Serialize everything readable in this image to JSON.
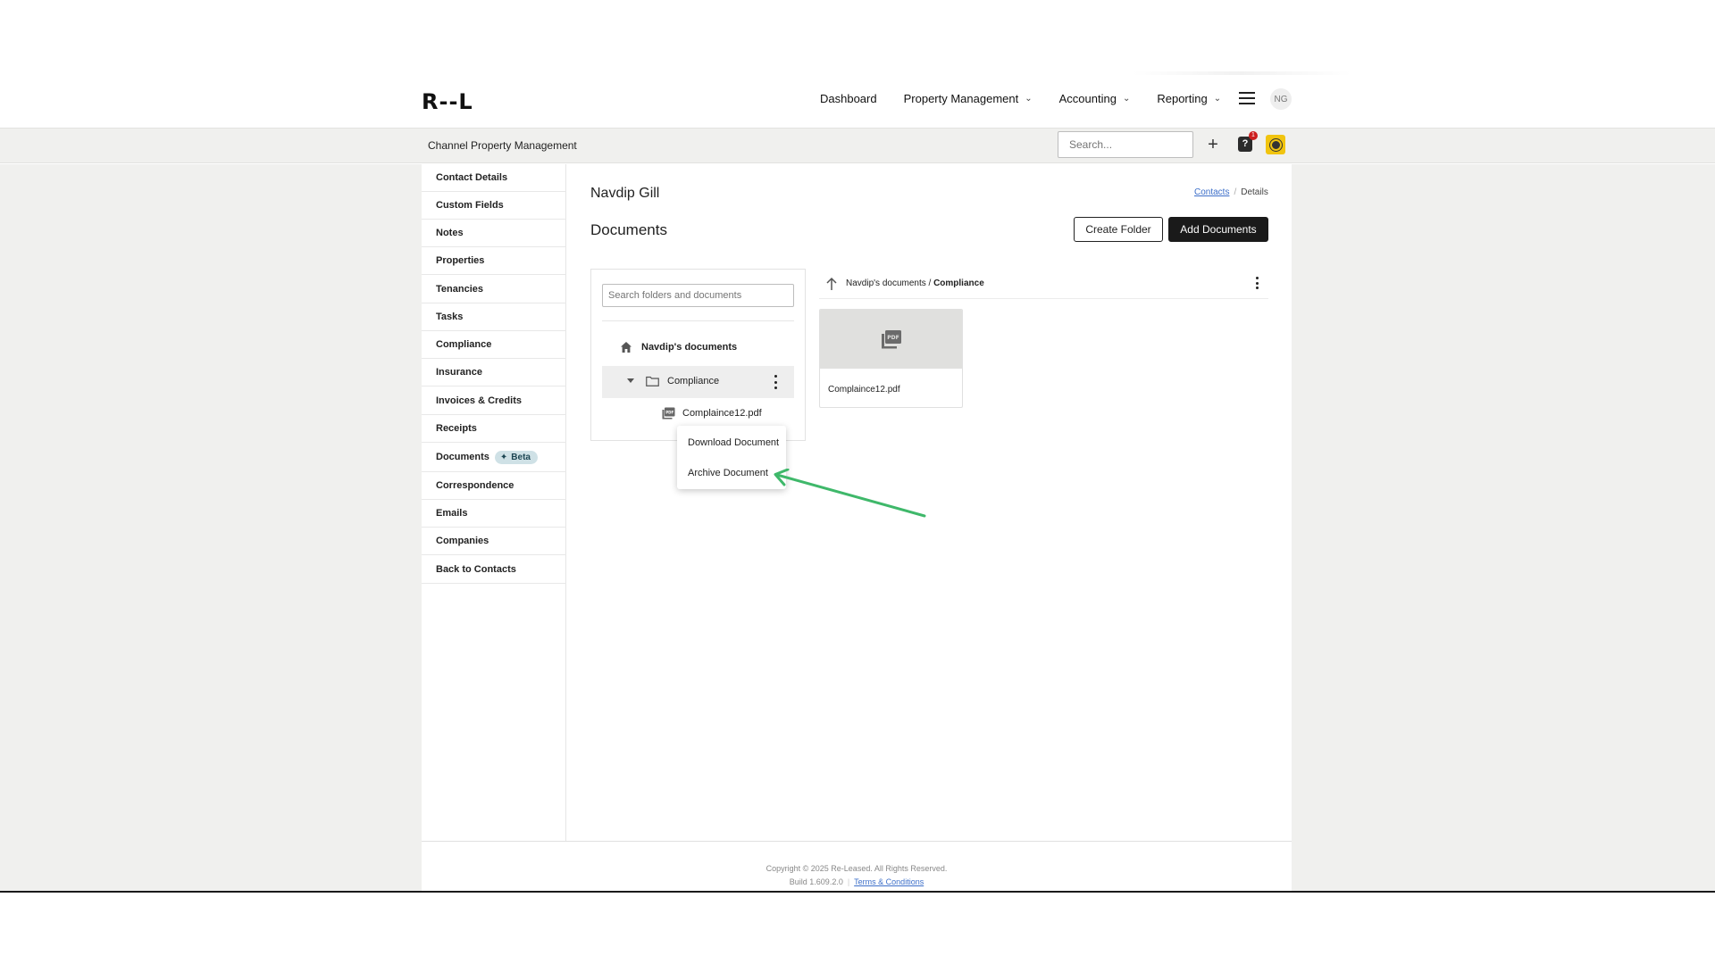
{
  "header": {
    "logo": "R--L",
    "nav": [
      {
        "label": "Dashboard",
        "has_dropdown": false
      },
      {
        "label": "Property Management",
        "has_dropdown": true
      },
      {
        "label": "Accounting",
        "has_dropdown": true
      },
      {
        "label": "Reporting",
        "has_dropdown": true
      }
    ],
    "avatar_initials": "NG"
  },
  "subheader": {
    "org_name": "Channel Property Management",
    "search_placeholder": "Search...",
    "plus_label": "+",
    "help_label": "?",
    "help_badge_count": "1"
  },
  "sidebar": {
    "items": [
      {
        "label": "Contact Details"
      },
      {
        "label": "Custom Fields"
      },
      {
        "label": "Notes"
      },
      {
        "label": "Properties"
      },
      {
        "label": "Tenancies"
      },
      {
        "label": "Tasks"
      },
      {
        "label": "Compliance"
      },
      {
        "label": "Insurance"
      },
      {
        "label": "Invoices & Credits"
      },
      {
        "label": "Receipts"
      },
      {
        "label": "Documents",
        "badge": "Beta"
      },
      {
        "label": "Correspondence"
      },
      {
        "label": "Emails"
      },
      {
        "label": "Companies"
      },
      {
        "label": "Back to Contacts"
      }
    ]
  },
  "main": {
    "contact_name": "Navdip Gill",
    "breadcrumb": {
      "link": "Contacts",
      "current": "Details"
    },
    "section_title": "Documents",
    "create_folder_label": "Create Folder",
    "add_documents_label": "Add Documents",
    "tree": {
      "search_placeholder": "Search folders and documents",
      "root_label": "Navdip's documents",
      "folder_label": "Compliance",
      "file_label": "Complaince12.pdf"
    },
    "context_menu": {
      "download_label": "Download Document",
      "archive_label": "Archive Document"
    },
    "browser": {
      "path_root": "Navdip's documents",
      "path_sep": "/",
      "path_current": "Compliance",
      "file_name": "Complaince12.pdf",
      "thumb_icon": "pdf-icon"
    }
  },
  "footer": {
    "copyright": "Copyright © 2025 Re-Leased. All Rights Reserved.",
    "build": "Build 1.609.2.0",
    "terms": "Terms & Conditions"
  },
  "colors": {
    "accent_dark": "#1a1a1a",
    "beta_badge_bg": "#cfe1e6",
    "annotation_arrow": "#3fb86a",
    "alert_badge": "#cc1e1e",
    "help_yellow": "#f1c40f"
  }
}
